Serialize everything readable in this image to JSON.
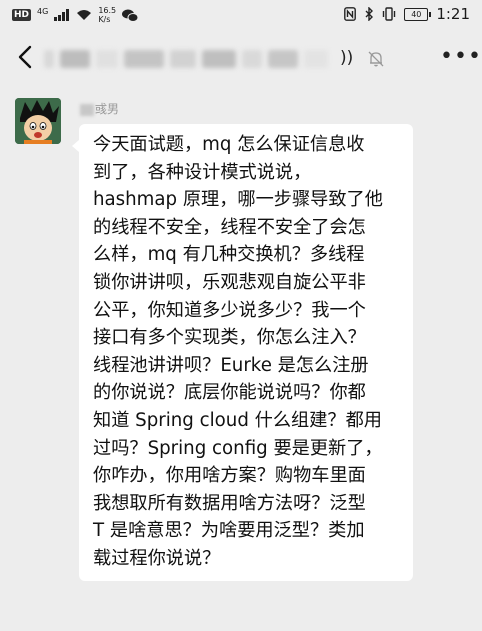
{
  "status_bar": {
    "network_badge": "HD",
    "network_type": "4G",
    "speed_value": "16.5",
    "speed_unit": "K/s",
    "battery": "40",
    "time": "1:21"
  },
  "chat_header": {
    "title_tail": "))"
  },
  "message": {
    "sender_name_visible": "彧男",
    "lines": [
      "今天面试题，mq 怎么保证信息收",
      "到了，各种设计模式说说，",
      "hashmap 原理，哪一步骤导致了他",
      "的线程不安全，线程不安全了会怎",
      "么样，mq 有几种交换机？多线程",
      "锁你讲讲呗，乐观悲观自旋公平非",
      "公平，你知道多少说多少？我一个",
      "接口有多个实现类，你怎么注入？",
      "线程池讲讲呗？Eurke 是怎么注册",
      "的你说说？底层你能说说吗？你都",
      "知道 Spring cloud 什么组建？都用",
      "过吗？Spring config 要是更新了，",
      "你咋办，你用啥方案？购物车里面",
      "我想取所有数据用啥方法呀？泛型",
      "T 是啥意思？为啥要用泛型？类加",
      "载过程你说说？"
    ]
  },
  "colors": {
    "background": "#ededed",
    "bubble": "#ffffff",
    "text": "#111111",
    "name": "#9a9a9a"
  }
}
